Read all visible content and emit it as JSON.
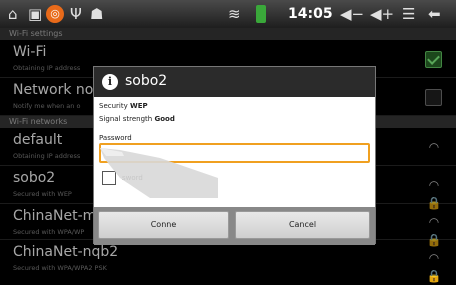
{
  "statusbar": {
    "time": "14:05",
    "left_icons": [
      "home-icon",
      "image-icon",
      "app-orange-icon",
      "usb-icon",
      "android-icon"
    ],
    "right_icons": [
      "wifi-icon",
      "battery-icon",
      "volume-down-icon",
      "volume-up-icon",
      "menu-icon",
      "back-icon"
    ]
  },
  "wifi_settings": {
    "section_label": "Wi-Fi settings",
    "wifi": {
      "title": "Wi-Fi",
      "subtitle": "Obtaining IP address",
      "checked": true
    },
    "network_notif": {
      "title": "Network notif",
      "subtitle": "Notify me when an o",
      "checked": false
    }
  },
  "networks_section_label": "Wi-Fi networks",
  "networks": [
    {
      "ssid": "default",
      "subtitle": "Obtaining IP address",
      "icon": "wifi-signal-icon"
    },
    {
      "ssid": "sobo2",
      "subtitle": "Secured with WEP",
      "icon": "wifi-locked-icon"
    },
    {
      "ssid": "ChinaNet-mN",
      "subtitle": "Secured with WPA/WP",
      "icon": "wifi-locked-icon"
    },
    {
      "ssid": "ChinaNet-nqb2",
      "subtitle": "Secured with WPA/WPA2 PSK",
      "icon": "wifi-locked-icon"
    }
  ],
  "dialog": {
    "title": "sobo2",
    "security_label": "Security",
    "security_value": "WEP",
    "strength_label": "Signal strength",
    "strength_value": "Good",
    "password_label": "Password",
    "password_value": "",
    "show_password_label": "sword",
    "connect_label": "Conne",
    "cancel_label": "Cancel"
  }
}
